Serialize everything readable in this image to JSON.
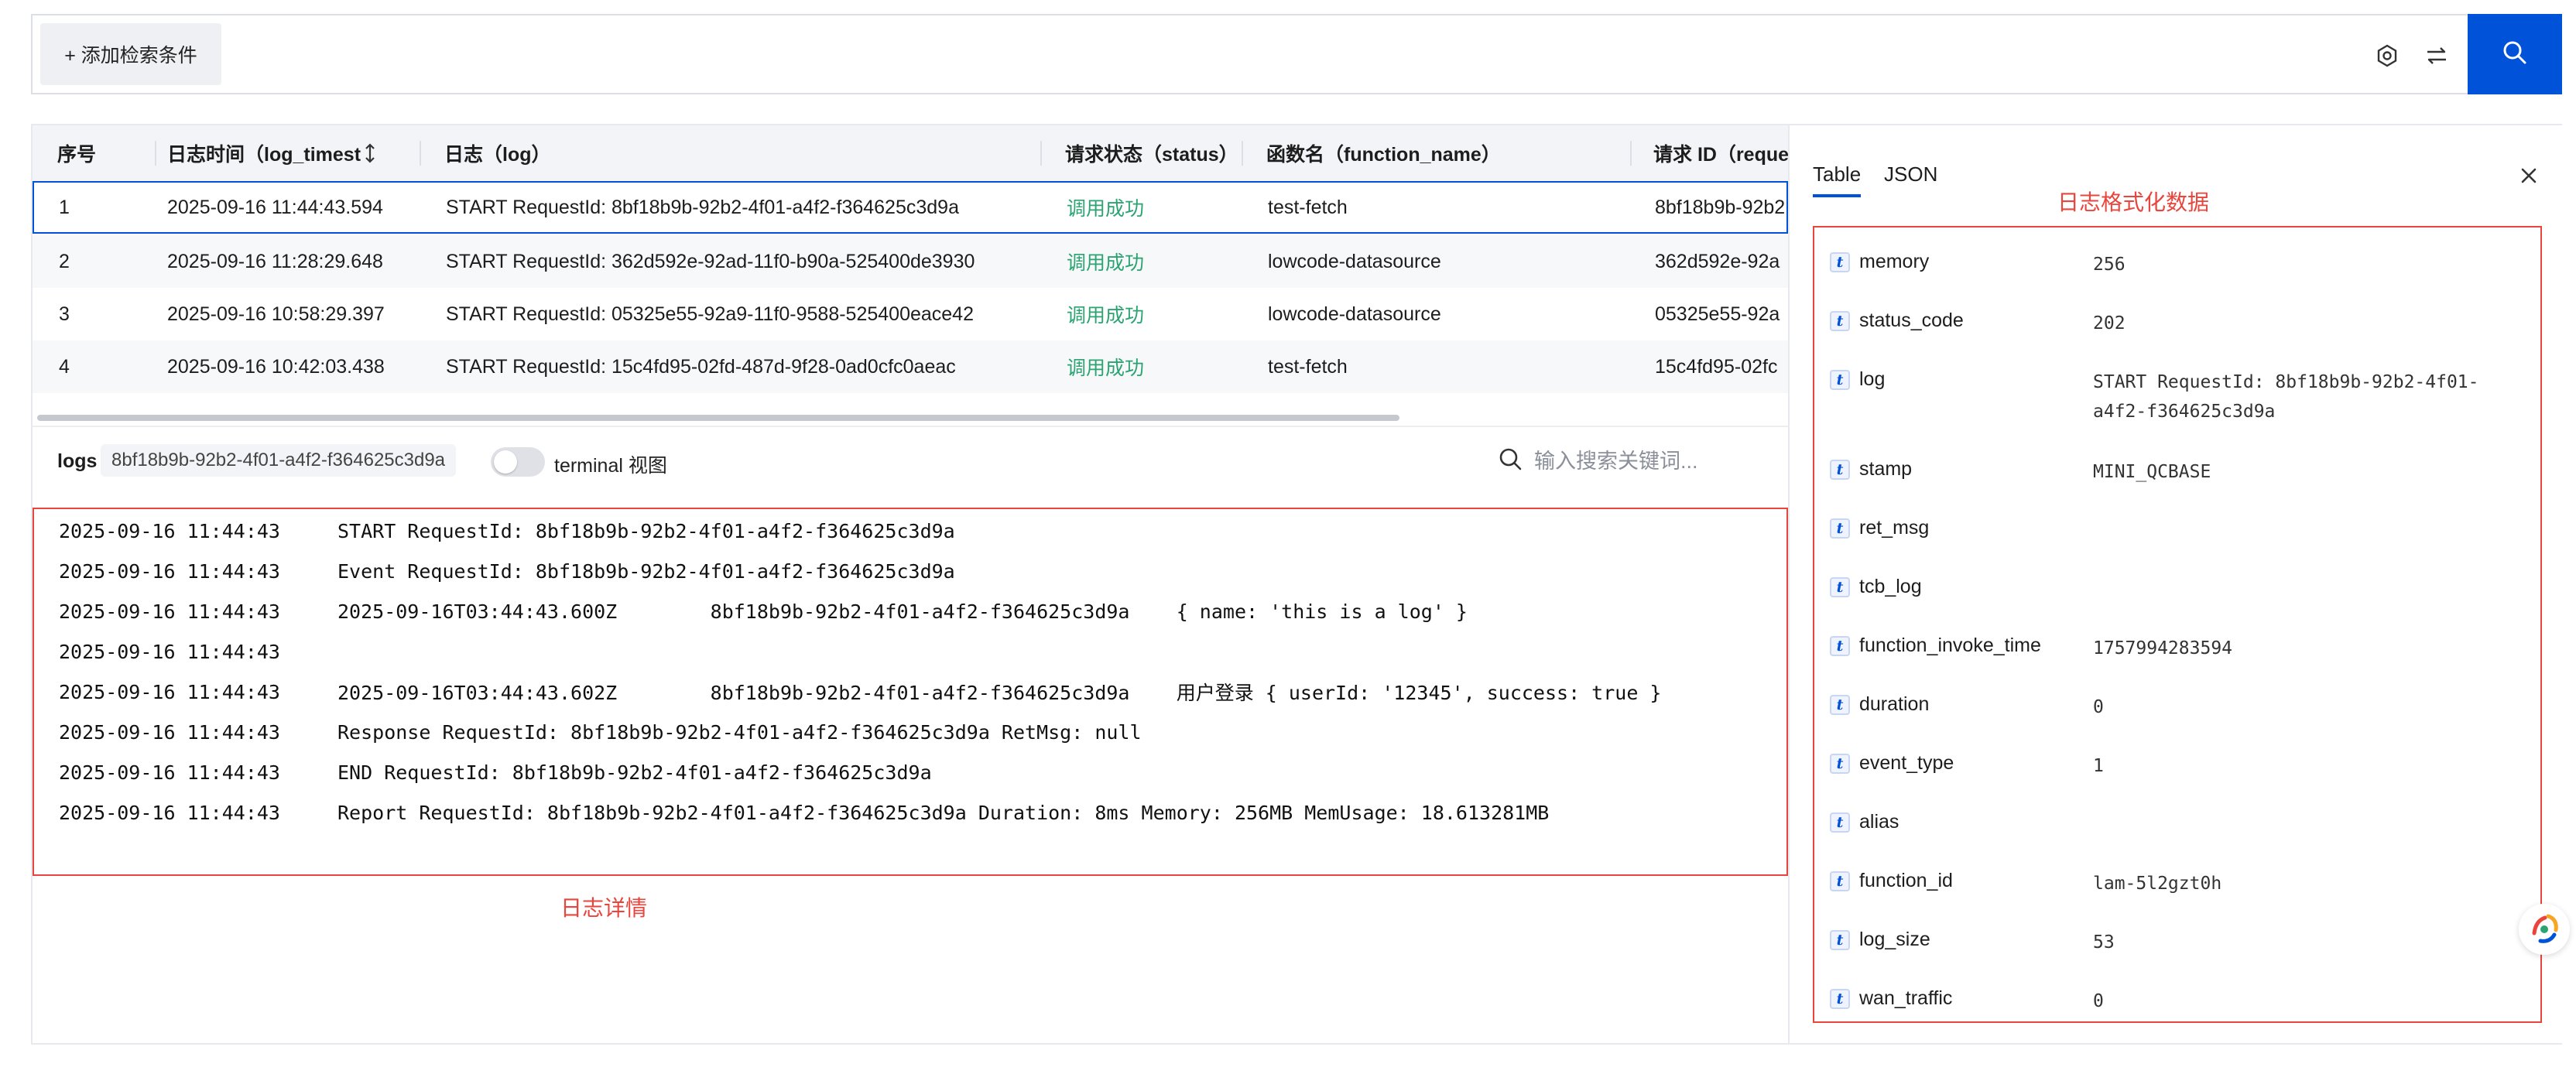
{
  "search_bar": {
    "add_condition_label": "+ 添加检索条件",
    "icons": [
      "settings-hexagon-icon",
      "filter-toggle-icon",
      "search-icon"
    ]
  },
  "table": {
    "headers": [
      "序号",
      "日志时间（log_timest",
      "日志（log）",
      "请求状态（status）",
      "函数名（function_name）",
      "请求 ID（reque"
    ],
    "sort_icon": "sort-icon",
    "rows": [
      {
        "index": "1",
        "time": "2025-09-16 11:44:43.594",
        "log": "START RequestId: 8bf18b9b-92b2-4f01-a4f2-f364625c3d9a",
        "status": "调用成功",
        "function": "test-fetch",
        "request_id": "8bf18b9b-92b2"
      },
      {
        "index": "2",
        "time": "2025-09-16 11:28:29.648",
        "log": "START RequestId: 362d592e-92ad-11f0-b90a-525400de3930",
        "status": "调用成功",
        "function": "lowcode-datasource",
        "request_id": "362d592e-92a"
      },
      {
        "index": "3",
        "time": "2025-09-16 10:58:29.397",
        "log": "START RequestId: 05325e55-92a9-11f0-9588-525400eace42",
        "status": "调用成功",
        "function": "lowcode-datasource",
        "request_id": "05325e55-92a"
      },
      {
        "index": "4",
        "time": "2025-09-16 10:42:03.438",
        "log": "START RequestId: 15c4fd95-02fd-487d-9f28-0ad0cfc0aeac",
        "status": "调用成功",
        "function": "test-fetch",
        "request_id": "15c4fd95-02fc"
      }
    ]
  },
  "logs": {
    "label": "logs",
    "request_id": "8bf18b9b-92b2-4f01-a4f2-f364625c3d9a",
    "terminal_toggle_label": "terminal 视图",
    "terminal_on": false,
    "search_placeholder": "输入搜索关键词...",
    "lines": [
      {
        "time": "2025-09-16 11:44:43",
        "msg": "START RequestId: 8bf18b9b-92b2-4f01-a4f2-f364625c3d9a"
      },
      {
        "time": "2025-09-16 11:44:43",
        "msg": "Event RequestId: 8bf18b9b-92b2-4f01-a4f2-f364625c3d9a"
      },
      {
        "time": "2025-09-16 11:44:43",
        "msg": "2025-09-16T03:44:43.600Z        8bf18b9b-92b2-4f01-a4f2-f364625c3d9a    { name: 'this is a log' }"
      },
      {
        "time": "2025-09-16 11:44:43",
        "msg": ""
      },
      {
        "time": "2025-09-16 11:44:43",
        "msg": "2025-09-16T03:44:43.602Z        8bf18b9b-92b2-4f01-a4f2-f364625c3d9a    用户登录 { userId: '12345', success: true }"
      },
      {
        "time": "2025-09-16 11:44:43",
        "msg": "Response RequestId: 8bf18b9b-92b2-4f01-a4f2-f364625c3d9a RetMsg: null"
      },
      {
        "time": "2025-09-16 11:44:43",
        "msg": "END RequestId: 8bf18b9b-92b2-4f01-a4f2-f364625c3d9a"
      },
      {
        "time": "2025-09-16 11:44:43",
        "msg": "Report RequestId: 8bf18b9b-92b2-4f01-a4f2-f364625c3d9a Duration: 8ms Memory: 256MB MemUsage: 18.613281MB"
      }
    ],
    "annotation": "日志详情"
  },
  "detail_panel": {
    "tabs": [
      "Table",
      "JSON"
    ],
    "active_tab": "Table",
    "annotation": "日志格式化数据",
    "type_badge": "t",
    "fields": [
      {
        "key": "memory",
        "value": "256"
      },
      {
        "key": "status_code",
        "value": "202"
      },
      {
        "key": "log",
        "value": "START RequestId: 8bf18b9b-92b2-4f01-a4f2-f364625c3d9a"
      },
      {
        "key": "stamp",
        "value": "MINI_QCBASE"
      },
      {
        "key": "ret_msg",
        "value": ""
      },
      {
        "key": "tcb_log",
        "value": ""
      },
      {
        "key": "function_invoke_time",
        "value": "1757994283594"
      },
      {
        "key": "duration",
        "value": "0"
      },
      {
        "key": "event_type",
        "value": "1"
      },
      {
        "key": "alias",
        "value": ""
      },
      {
        "key": "function_id",
        "value": "lam-5l2gzt0h"
      },
      {
        "key": "log_size",
        "value": "53"
      },
      {
        "key": "wan_traffic",
        "value": "0"
      }
    ]
  },
  "colors": {
    "primary": "#0052d9",
    "success": "#2ba471",
    "annotation_red": "#e8453c"
  }
}
